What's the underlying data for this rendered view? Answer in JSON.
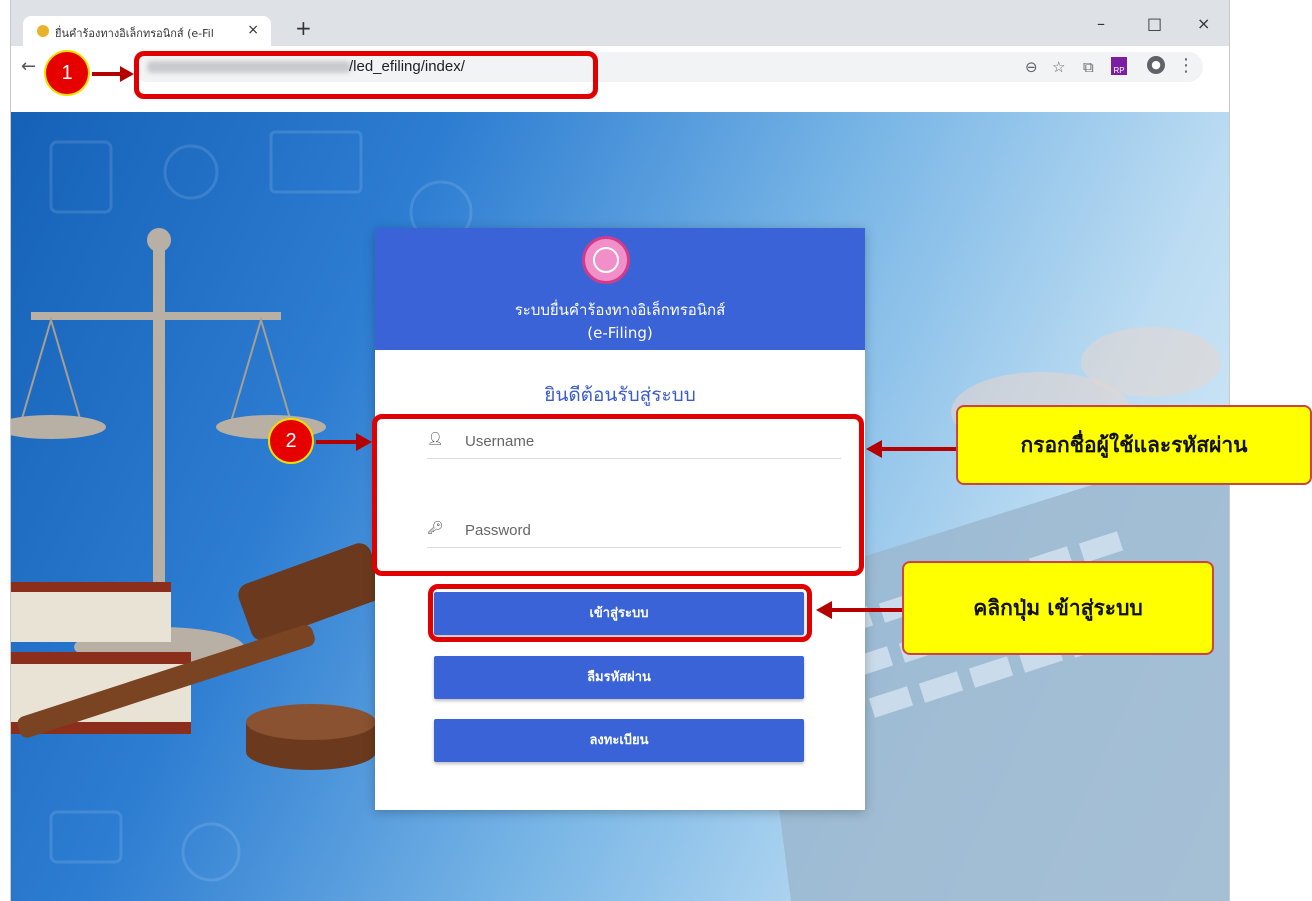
{
  "browser": {
    "tab_title": "ยื่นคำร้องทางอิเล็กทรอนิกส์ (e-Fil",
    "tab_close": "×",
    "new_tab": "+",
    "minimize": "–",
    "maximize": "□",
    "close": "×",
    "url": "/led_efiling/index/",
    "ext_rp": "RP",
    "menu": "⋮"
  },
  "card": {
    "system_title": "ระบบยื่นคำร้องทางอิเล็กทรอนิกส์",
    "system_subtitle": "(e-Filing)",
    "welcome": "ยินดีต้อนรับสู่ระบบ",
    "username_placeholder": "Username",
    "password_placeholder": "Password",
    "login_label": "เข้าสู่ระบบ",
    "forgot_label": "ลืมรหัสผ่าน",
    "register_label": "ลงทะเบียน"
  },
  "annotations": {
    "marker_1": "1",
    "marker_2": "2",
    "callout_fields": "กรอกชื่อผู้ใช้และรหัสผ่าน",
    "callout_login": "คลิกปุ่ม เข้าสู่ระบบ"
  },
  "colors": {
    "primary": "#3a63d8",
    "annotation_red": "#e10000",
    "callout_yellow": "#ffff00"
  }
}
